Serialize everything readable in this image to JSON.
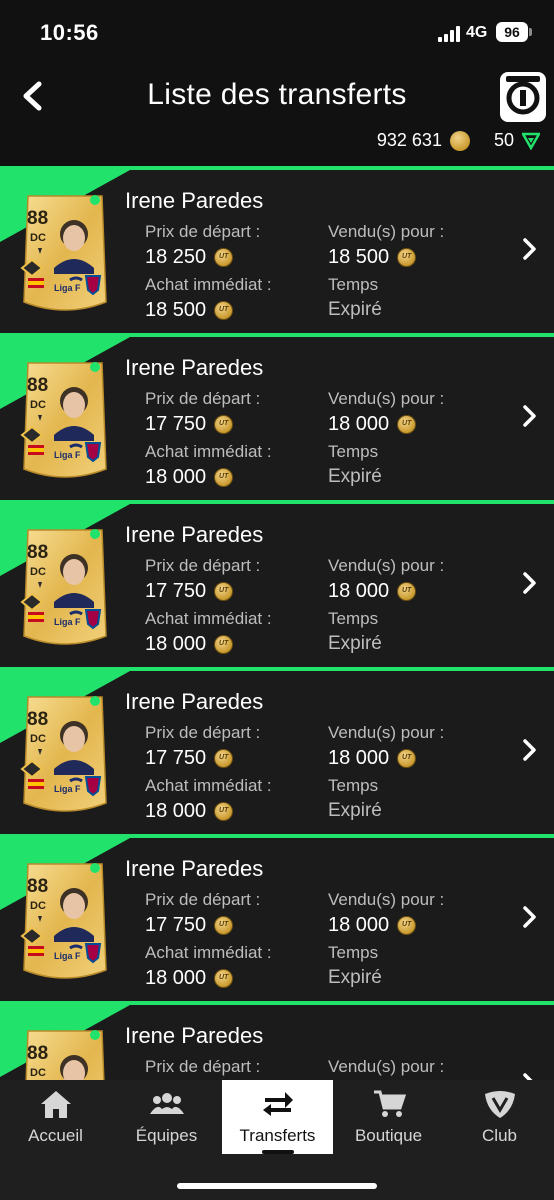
{
  "status_bar": {
    "time": "10:56",
    "network": "4G",
    "battery": "96"
  },
  "header": {
    "title": "Liste des transferts",
    "coins": "932 631",
    "points": "50"
  },
  "card_common": {
    "rating": "88",
    "position": "DC",
    "league": "Liga F"
  },
  "labels": {
    "start_price": "Prix de départ :",
    "buy_now": "Achat immédiat :",
    "sold_for": "Vendu(s) pour :",
    "time": "Temps"
  },
  "items": [
    {
      "name": "Irene Paredes",
      "start_price": "18 250",
      "buy_now": "18 500",
      "sold_for": "18 500",
      "time": "Expiré"
    },
    {
      "name": "Irene Paredes",
      "start_price": "17 750",
      "buy_now": "18 000",
      "sold_for": "18 000",
      "time": "Expiré"
    },
    {
      "name": "Irene Paredes",
      "start_price": "17 750",
      "buy_now": "18 000",
      "sold_for": "18 000",
      "time": "Expiré"
    },
    {
      "name": "Irene Paredes",
      "start_price": "17 750",
      "buy_now": "18 000",
      "sold_for": "18 000",
      "time": "Expiré"
    },
    {
      "name": "Irene Paredes",
      "start_price": "17 750",
      "buy_now": "18 000",
      "sold_for": "18 000",
      "time": "Expiré"
    },
    {
      "name": "Irene Paredes",
      "start_price": "",
      "buy_now": "",
      "sold_for": "",
      "time": ""
    }
  ],
  "nav": [
    {
      "label": "Accueil",
      "icon": "home-icon"
    },
    {
      "label": "Équipes",
      "icon": "users-icon"
    },
    {
      "label": "Transferts",
      "icon": "transfer-arrows-icon",
      "active": true
    },
    {
      "label": "Boutique",
      "icon": "cart-icon"
    },
    {
      "label": "Club",
      "icon": "club-icon"
    }
  ],
  "colors": {
    "accent": "#21e36b",
    "card_gold": "#e9c463",
    "background": "#111111"
  }
}
